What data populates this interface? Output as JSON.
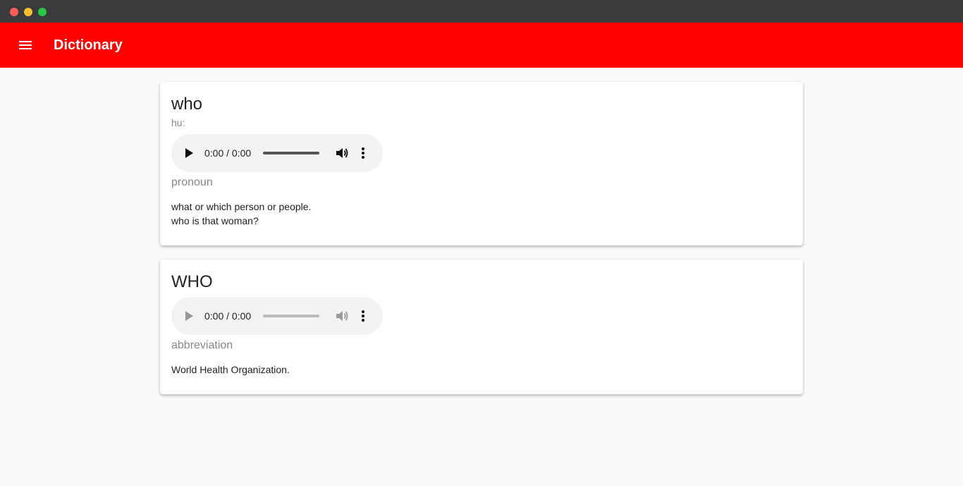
{
  "app": {
    "title": "Dictionary",
    "accent": "#ff0000"
  },
  "entries": [
    {
      "word": "who",
      "phonetic": "hu:",
      "audio": {
        "time": "0:00 / 0:00",
        "enabled": true
      },
      "part_of_speech": "pronoun",
      "definition": "what or which person or people.",
      "example": "who is that woman?"
    },
    {
      "word": "WHO",
      "audio": {
        "time": "0:00 / 0:00",
        "enabled": false
      },
      "part_of_speech": "abbreviation",
      "definition": "World Health Organization."
    }
  ]
}
